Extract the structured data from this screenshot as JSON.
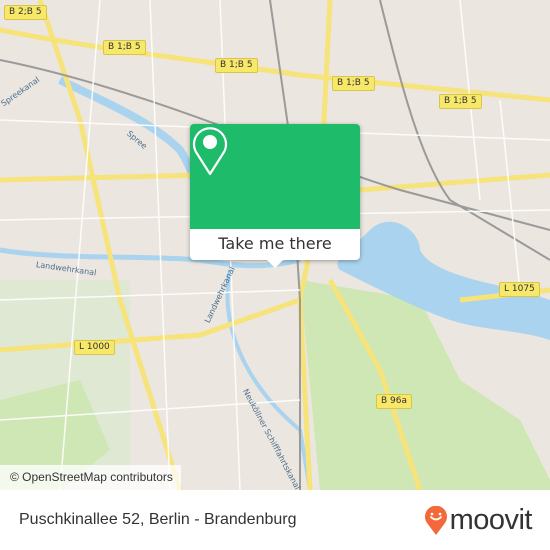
{
  "map": {
    "road_shields": [
      "B 2;B 5",
      "B 1;B 5",
      "B 1;B 5",
      "B 1;B 5",
      "L 1075",
      "L 1000",
      "B 96a"
    ],
    "water_labels": [
      "Spreekanal",
      "Spree",
      "Landwehrkanal",
      "Landwehrkanal",
      "Neuköllner Schifffahrtskanal"
    ],
    "attribution": "© OpenStreetMap contributors",
    "colors": {
      "water": "#a9d3ee",
      "park": "#cfe6b5",
      "road_major": "#f6e37a",
      "background": "#ebe6df"
    }
  },
  "popup": {
    "icon": "map-pin-icon",
    "button_label": "Take me there",
    "color": "#1dbb6a"
  },
  "footer": {
    "address": "Puschkinallee 52, Berlin - Brandenburg",
    "logo_text": "moovit",
    "logo_color": "#f26a3b"
  }
}
